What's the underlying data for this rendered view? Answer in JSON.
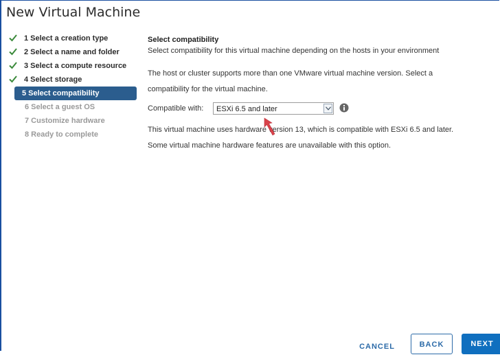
{
  "window": {
    "title": "New Virtual Machine"
  },
  "nav": {
    "items": [
      {
        "label": "1 Select a creation type",
        "state": "done"
      },
      {
        "label": "2 Select a name and folder",
        "state": "done"
      },
      {
        "label": "3 Select a compute resource",
        "state": "done"
      },
      {
        "label": "4 Select storage",
        "state": "done"
      },
      {
        "label": "5 Select compatibility",
        "state": "current"
      },
      {
        "label": "6 Select a guest OS",
        "state": "future"
      },
      {
        "label": "7 Customize hardware",
        "state": "future"
      },
      {
        "label": "8 Ready to complete",
        "state": "future"
      }
    ]
  },
  "main": {
    "heading": "Select compatibility",
    "subheading": "Select compatibility for this virtual machine depending on the hosts in your environment",
    "para1_line1": "The host or cluster supports more than one VMware virtual machine version. Select a",
    "para1_line2": "compatibility for the virtual machine.",
    "compat_label": "Compatible with:",
    "compat_value": "ESXi 6.5 and later",
    "desc_line1": "This virtual machine uses hardware version 13, which is compatible with ESXi 6.5 and later.",
    "desc_line2": "Some virtual machine hardware features are unavailable with this option."
  },
  "footer": {
    "cancel": "CANCEL",
    "back": "BACK",
    "next": "NEXT"
  },
  "colors": {
    "accent": "#2b5d8e",
    "check": "#3b8a3b",
    "primary": "#0f6fbf",
    "pointer": "#d9434b"
  },
  "icons": {
    "check": "checkmark-icon",
    "info": "info-icon",
    "dropdown": "chevron-down-icon",
    "pointer": "arrow-pointer-icon"
  }
}
